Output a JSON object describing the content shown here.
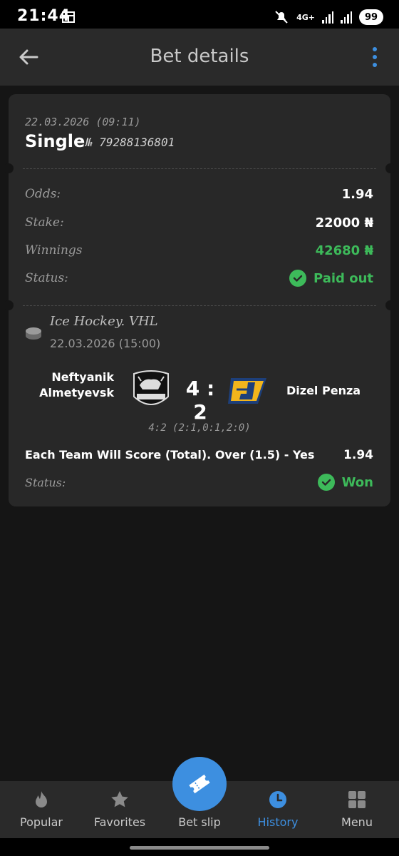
{
  "status_bar": {
    "time": "21:44",
    "network": "4G+",
    "battery": "99"
  },
  "header": {
    "title": "Bet details"
  },
  "bet": {
    "date": "22.03.2026 (09:11)",
    "type": "Single",
    "number": "№ 79288136801",
    "odds_label": "Odds:",
    "odds_value": "1.94",
    "stake_label": "Stake:",
    "stake_value": "22000 ₦",
    "winnings_label": "Winnings",
    "winnings_value": "42680 ₦",
    "status_label": "Status:",
    "status_value": "Paid out"
  },
  "event": {
    "icon": "hockey-puck-icon",
    "league": "Ice Hockey. VHL",
    "date": "22.03.2026 (15:00)",
    "team1_line1": "Neftyanik",
    "team1_line2": "Almetyevsk",
    "score": "4 : 2",
    "team2": "Dizel Penza",
    "periods": "4:2 (2:1,0:1,2:0)",
    "market": "Each Team Will Score (Total). Over (1.5) - Yes",
    "market_odds": "1.94",
    "status_label": "Status:",
    "status_value": "Won"
  },
  "colors": {
    "accent": "#3d8fe0",
    "success": "#3dba5a"
  },
  "nav": {
    "items": [
      {
        "label": "Popular",
        "icon": "flame-icon"
      },
      {
        "label": "Favorites",
        "icon": "star-icon"
      },
      {
        "label": "Bet slip",
        "icon": "ticket-icon"
      },
      {
        "label": "History",
        "icon": "clock-icon"
      },
      {
        "label": "Menu",
        "icon": "grid-icon"
      }
    ]
  }
}
